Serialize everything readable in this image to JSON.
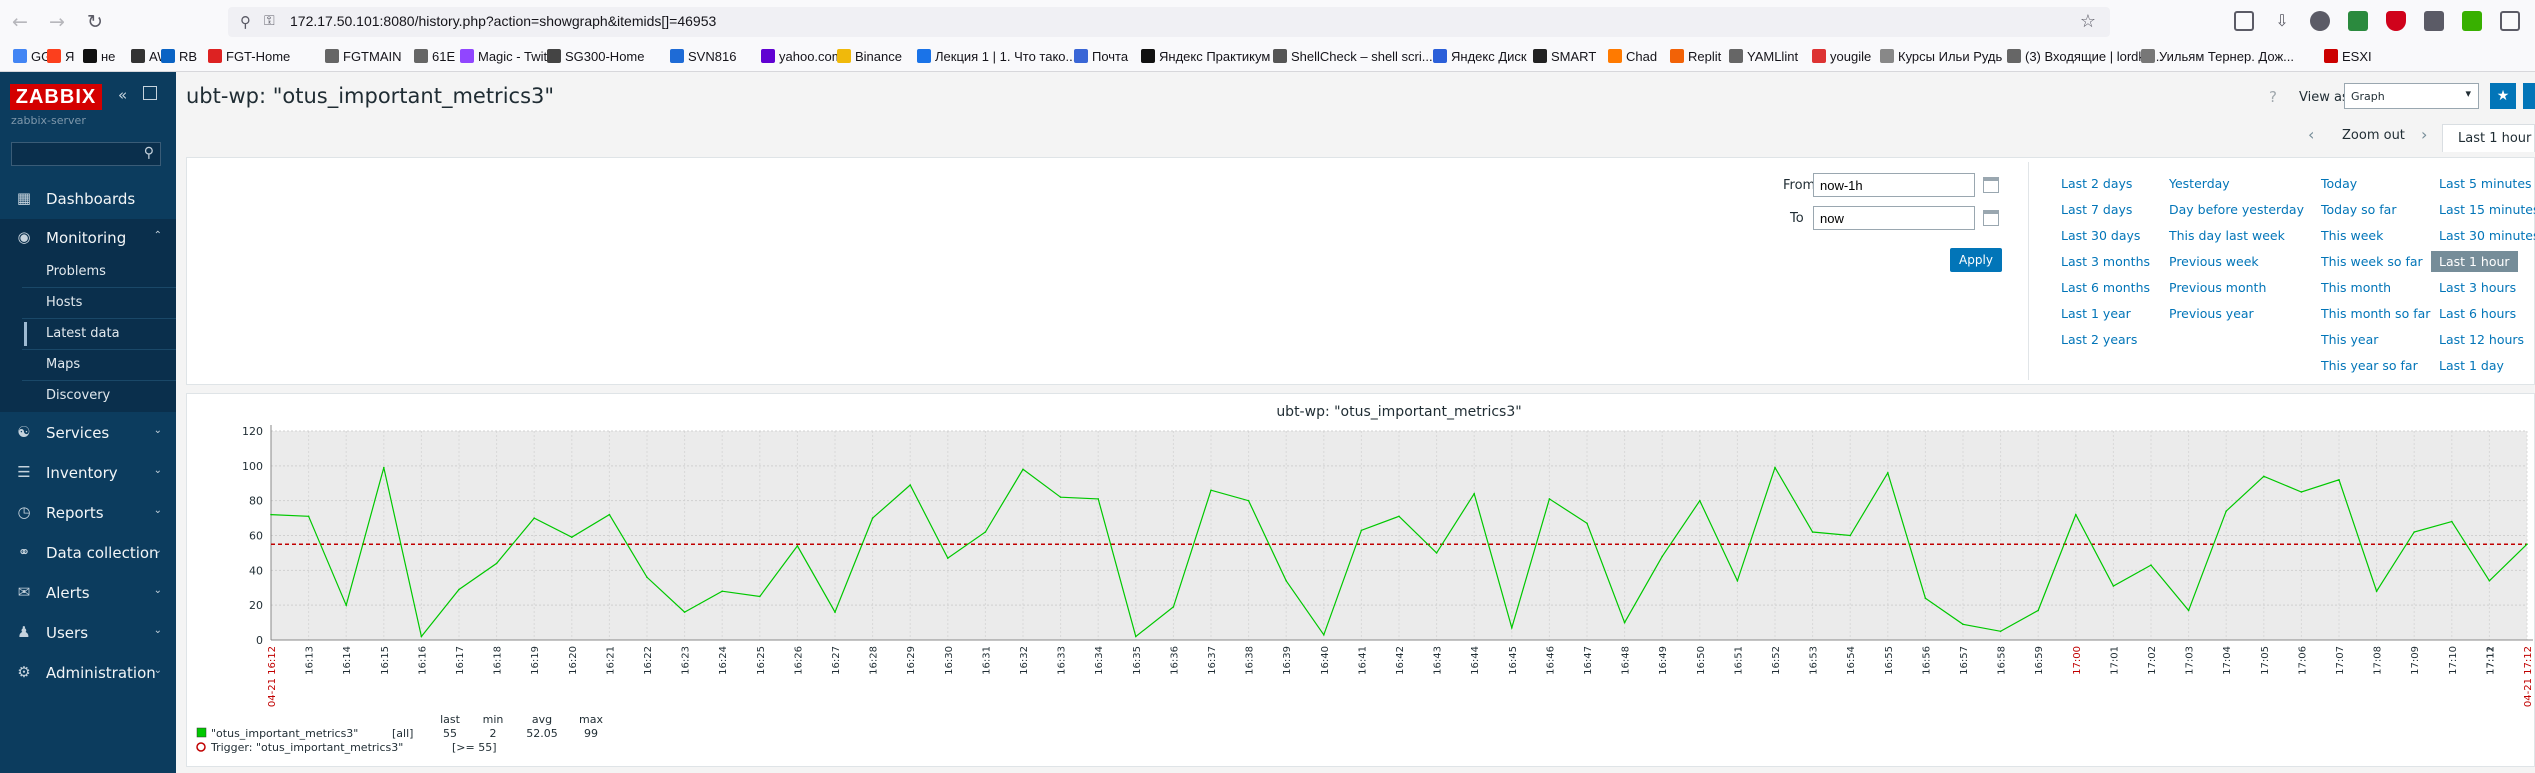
{
  "browser": {
    "url": "172.17.50.101:8080/history.php?action=showgraph&itemids[]=46953",
    "bookmarks": [
      "GG",
      "Я",
      "не",
      "AW",
      "RB",
      "FGT-Home",
      "FGTMAIN",
      "61E",
      "Magic - Twitch",
      "SG300-Home",
      "SVN816",
      "yahoo.com",
      "Binance",
      "Лекция 1 | 1. Что тако...",
      "Почта",
      "Яндекс Практикум",
      "ShellCheck – shell scri...",
      "Яндекс Диск",
      "SMART",
      "Chad",
      "Replit",
      "YAMLlint",
      "yougile",
      "Курсы Ильи Рудь",
      "(3) Входящие | lordku...",
      "Уильям Тернер. Дож...",
      "ESXI"
    ]
  },
  "sidebar": {
    "logo": "ZABBIX",
    "server": "zabbix-server",
    "menu": {
      "dashboards": "Dashboards",
      "monitoring": "Monitoring",
      "services": "Services",
      "inventory": "Inventory",
      "reports": "Reports",
      "data_collection": "Data collection",
      "alerts": "Alerts",
      "users": "Users",
      "administration": "Administration"
    },
    "submenu": [
      "Problems",
      "Hosts",
      "Latest data",
      "Maps",
      "Discovery"
    ]
  },
  "header": {
    "title": "ubt-wp: \"otus_important_metrics3\"",
    "view_as_label": "View as",
    "view_as_value": "Graph"
  },
  "timenav": {
    "zoom_out": "Zoom out",
    "current": "Last 1 hour"
  },
  "filter": {
    "from_label": "From",
    "from_value": "now-1h",
    "to_label": "To",
    "to_value": "now",
    "apply": "Apply",
    "quick_ranges": [
      [
        "Last 2 days",
        "Last 7 days",
        "Last 30 days",
        "Last 3 months",
        "Last 6 months",
        "Last 1 year",
        "Last 2 years"
      ],
      [
        "Yesterday",
        "Day before yesterday",
        "This day last week",
        "Previous week",
        "Previous month",
        "Previous year"
      ],
      [
        "Today",
        "Today so far",
        "This week",
        "This week so far",
        "This month",
        "This month so far",
        "This year",
        "This year so far"
      ],
      [
        "Last 5 minutes",
        "Last 15 minutes",
        "Last 30 minutes",
        "Last 1 hour",
        "Last 3 hours",
        "Last 6 hours",
        "Last 12 hours",
        "Last 1 day"
      ]
    ],
    "selected": "Last 1 hour"
  },
  "chart_data": {
    "type": "line",
    "title": "ubt-wp: \"otus_important_metrics3\"",
    "ylim": [
      0,
      120
    ],
    "yticks": [
      "0",
      "20",
      "40",
      "60",
      "80",
      "100",
      "120"
    ],
    "x_start_label": "04-21 16:12",
    "x_end_label": "04-21 17:12",
    "x_labels": [
      "16:13",
      "16:14",
      "16:15",
      "16:16",
      "16:17",
      "16:18",
      "16:19",
      "16:20",
      "16:21",
      "16:22",
      "16:23",
      "16:24",
      "16:25",
      "16:26",
      "16:27",
      "16:28",
      "16:29",
      "16:30",
      "16:31",
      "16:32",
      "16:33",
      "16:34",
      "16:35",
      "16:36",
      "16:37",
      "16:38",
      "16:39",
      "16:40",
      "16:41",
      "16:42",
      "16:43",
      "16:44",
      "16:45",
      "16:46",
      "16:47",
      "16:48",
      "16:49",
      "16:50",
      "16:51",
      "16:52",
      "16:53",
      "16:54",
      "16:55",
      "16:56",
      "16:57",
      "16:58",
      "16:59",
      "17:00",
      "17:01",
      "17:02",
      "17:03",
      "17:04",
      "17:05",
      "17:06",
      "17:07",
      "17:08",
      "17:09",
      "17:10",
      "17:11",
      "17:12"
    ],
    "highlight_labels": [
      "17:00"
    ],
    "series": [
      {
        "name": "\"otus_important_metrics3\"",
        "color": "#00c800",
        "values": [
          72,
          71,
          20,
          99,
          2,
          29,
          44,
          70,
          59,
          72,
          36,
          16,
          28,
          25,
          54,
          16,
          70,
          89,
          47,
          62,
          98,
          82,
          81,
          2,
          19,
          86,
          80,
          34,
          3,
          63,
          71,
          50,
          84,
          7,
          81,
          67,
          10,
          48,
          80,
          34,
          99,
          62,
          60,
          96,
          24,
          9,
          5,
          17,
          72,
          31,
          43,
          17,
          74,
          94,
          85,
          92,
          28,
          62,
          68,
          34,
          55
        ],
        "agg": "[all]",
        "last": "55",
        "min": "2",
        "avg": "52.05",
        "max": "99"
      }
    ],
    "legend": {
      "last": "last",
      "min": "min",
      "avg": "avg",
      "max": "max"
    },
    "trigger": {
      "label": "Trigger: \"otus_important_metrics3\"",
      "cond": "[>= 55]",
      "value": 55,
      "color": "#c00000"
    },
    "grid": true
  }
}
